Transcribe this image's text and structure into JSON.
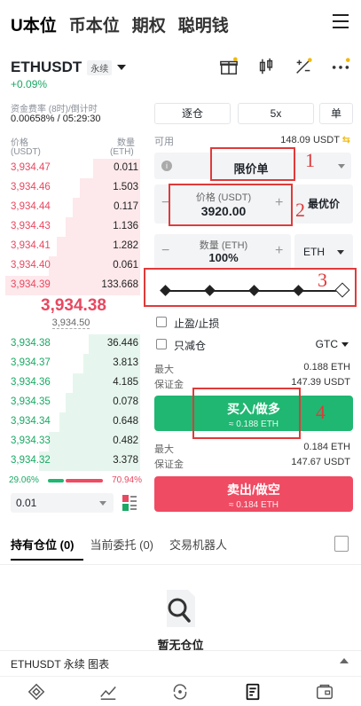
{
  "topnav": {
    "items": [
      "U本位",
      "币本位",
      "期权",
      "聪明钱"
    ],
    "active": 0
  },
  "symbol": {
    "name": "ETHUSDT",
    "tag": "永续",
    "change": "+0.09%"
  },
  "funding": {
    "label": "资金费率 (8时)/倒计时",
    "value": "0.00658% / 05:29:30"
  },
  "orderbook": {
    "price_header": "价格",
    "price_unit": "(USDT)",
    "qty_header": "数量",
    "qty_unit": "(ETH)",
    "asks": [
      {
        "price": "3,934.47",
        "qty": "0.011",
        "depth": 0.35
      },
      {
        "price": "3,934.46",
        "qty": "1.503",
        "depth": 0.45
      },
      {
        "price": "3,934.44",
        "qty": "0.117",
        "depth": 0.5
      },
      {
        "price": "3,934.43",
        "qty": "1.136",
        "depth": 0.55
      },
      {
        "price": "3,934.41",
        "qty": "1.282",
        "depth": 0.62
      },
      {
        "price": "3,934.40",
        "qty": "0.061",
        "depth": 0.68
      },
      {
        "price": "3,934.39",
        "qty": "133.668",
        "depth": 1.0
      }
    ],
    "mid_price": "3,934.38",
    "mark_price": "3,934.50",
    "bids": [
      {
        "price": "3,934.38",
        "qty": "36.446",
        "depth": 0.38
      },
      {
        "price": "3,934.37",
        "qty": "3.813",
        "depth": 0.42
      },
      {
        "price": "3,934.36",
        "qty": "4.185",
        "depth": 0.5
      },
      {
        "price": "3,934.35",
        "qty": "0.078",
        "depth": 0.55
      },
      {
        "price": "3,934.34",
        "qty": "0.648",
        "depth": 0.6
      },
      {
        "price": "3,934.33",
        "qty": "0.482",
        "depth": 0.68
      },
      {
        "price": "3,934.32",
        "qty": "3.378",
        "depth": 0.75
      }
    ],
    "buy_ratio": "29.06%",
    "sell_ratio": "70.94%",
    "buy_ratio_value": 0.2906,
    "depth_value": "0.01"
  },
  "trade": {
    "margin_mode": "逐仓",
    "leverage": "5x",
    "position_mode": "单",
    "available_label": "可用",
    "available_value": "148.09 USDT",
    "order_type": "限价单",
    "price_label": "价格 (USDT)",
    "price_value": "3920.00",
    "best_price": "最优价",
    "qty_label": "数量 (ETH)",
    "qty_value": "100%",
    "qty_unit": "ETH",
    "slider_value": 1.0,
    "tpsl_label": "止盈/止损",
    "reduce_only_label": "只减仓",
    "tif": "GTC",
    "buy_max_label": "最大",
    "buy_max_value": "0.188 ETH",
    "buy_margin_label": "保证金",
    "buy_margin_value": "147.39 USDT",
    "buy_button": "买入/做多",
    "buy_sub": "≈ 0.188 ETH",
    "sell_max_label": "最大",
    "sell_max_value": "0.184 ETH",
    "sell_margin_label": "保证金",
    "sell_margin_value": "147.67 USDT",
    "sell_button": "卖出/做空",
    "sell_sub": "≈ 0.184 ETH"
  },
  "annotations": [
    "1",
    "2",
    "3",
    "4"
  ],
  "bottom_tabs": {
    "items": [
      "持有仓位 (0)",
      "当前委托 (0)",
      "交易机器人"
    ],
    "active": 0
  },
  "empty_text": "暂无仓位",
  "chart_bar": "ETHUSDT 永续 图表",
  "colors": {
    "buy": "#1fb771",
    "sell": "#ef4b63",
    "annotation": "#e03a3a"
  }
}
